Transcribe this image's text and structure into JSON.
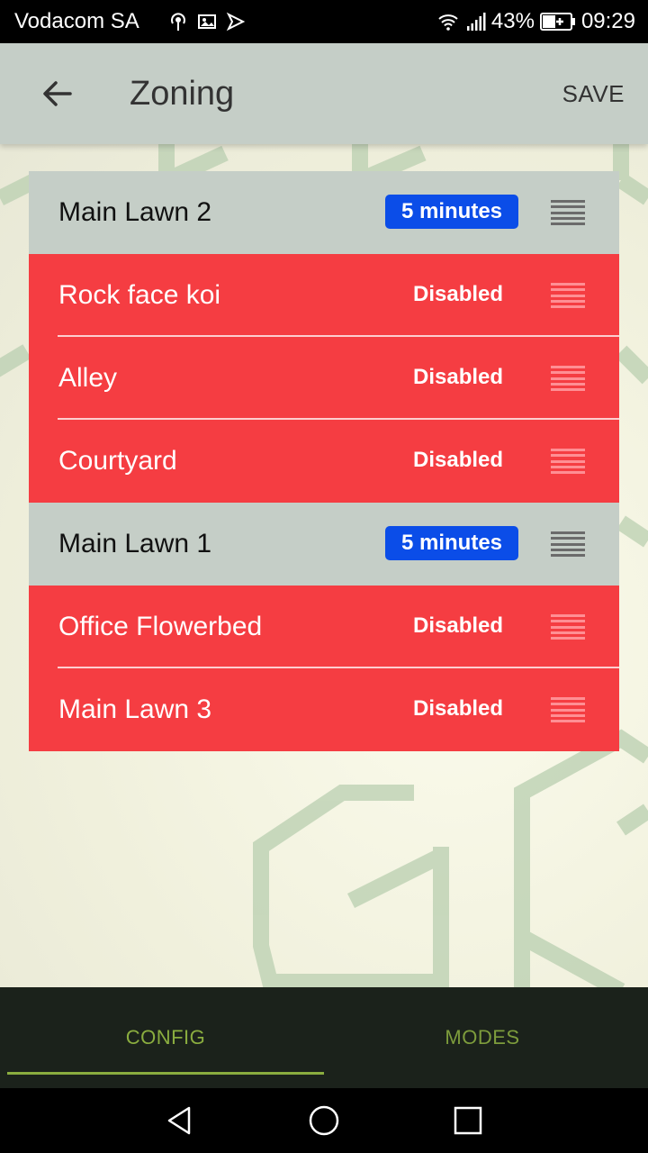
{
  "status_bar": {
    "carrier": "Vodacom SA",
    "battery": "43%",
    "time": "09:29"
  },
  "app_bar": {
    "title": "Zoning",
    "save_label": "SAVE"
  },
  "zones": [
    {
      "name": "Main Lawn 2",
      "type": "group",
      "badge": "5 minutes"
    },
    {
      "name": "Rock face koi",
      "type": "zone",
      "status": "Disabled"
    },
    {
      "name": "Alley",
      "type": "zone",
      "status": "Disabled"
    },
    {
      "name": "Courtyard",
      "type": "zone",
      "status": "Disabled"
    },
    {
      "name": "Main Lawn 1",
      "type": "group",
      "badge": "5 minutes"
    },
    {
      "name": "Office Flowerbed",
      "type": "zone",
      "status": "Disabled"
    },
    {
      "name": "Main Lawn 3",
      "type": "zone",
      "status": "Disabled"
    }
  ],
  "tabs": [
    {
      "label": "CONFIG",
      "active": true
    },
    {
      "label": "MODES",
      "active": false
    }
  ],
  "colors": {
    "group_row": "#c5cec7",
    "disabled_row": "#f53d42",
    "badge": "#0b4de8",
    "tab_accent": "#8aad3f"
  }
}
